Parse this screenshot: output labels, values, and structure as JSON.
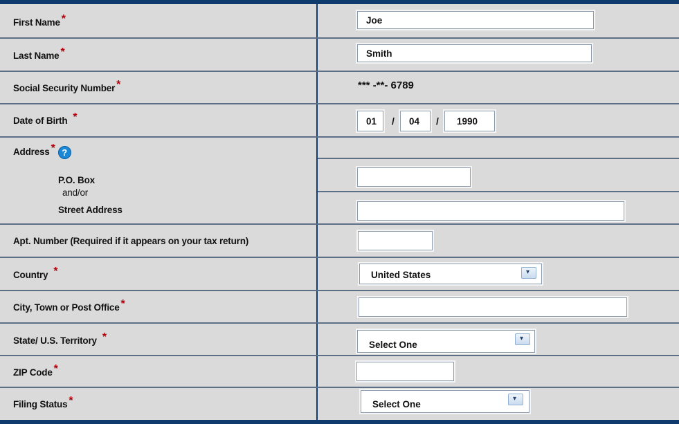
{
  "labels": {
    "first_name": "First Name",
    "last_name": "Last Name",
    "ssn": "Social Security Number",
    "dob": "Date of Birth",
    "address": "Address",
    "po_box": "P.O. Box",
    "and_or": "and/or",
    "street": "Street Address",
    "apt": "Apt. Number (Required if it appears on your tax return)",
    "country": "Country",
    "city": "City, Town or Post Office",
    "state": "State/ U.S. Territory",
    "zip": "ZIP Code",
    "filing": "Filing Status"
  },
  "required_mark": "*",
  "help_glyph": "?",
  "values": {
    "first_name": "Joe",
    "last_name": "Smith",
    "ssn_masked": "*** -**- 6789",
    "dob_month": "01",
    "dob_day": "04",
    "dob_year": "1990",
    "date_separator": "/",
    "po_box": "",
    "street": "",
    "apt": "",
    "country": "United States",
    "city": "",
    "state": "Select One",
    "zip": "",
    "filing": "Select One"
  },
  "dropdown_glyph": "▾",
  "colors": {
    "frame": "#0f3a6e",
    "panel": "#dadada",
    "required": "#b0000b",
    "help": "#1a88d6"
  }
}
